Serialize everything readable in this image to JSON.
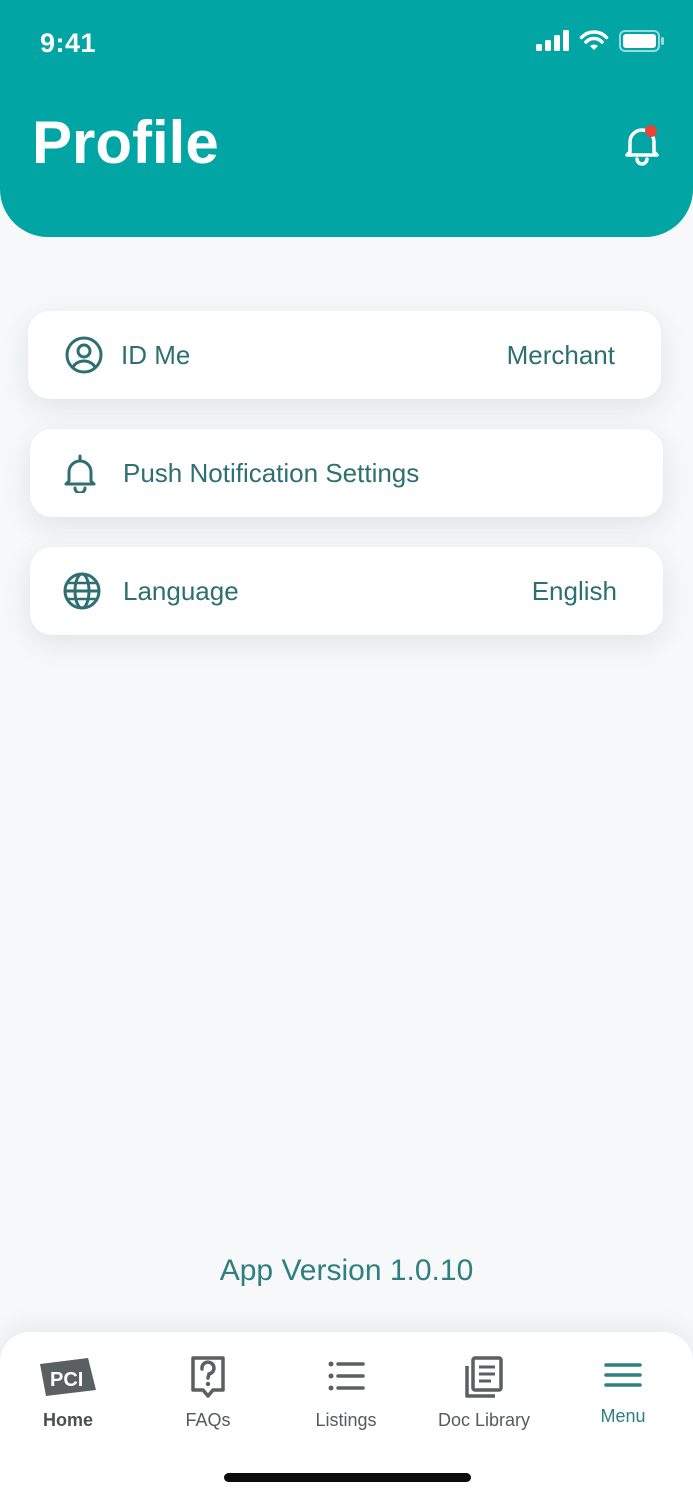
{
  "status_bar": {
    "time": "9:41"
  },
  "header": {
    "title": "Profile"
  },
  "settings": [
    {
      "label": "ID Me",
      "value": "Merchant",
      "icon": "user-circle-icon"
    },
    {
      "label": "Push Notification Settings",
      "value": "",
      "icon": "bell-icon"
    },
    {
      "label": "Language",
      "value": "English",
      "icon": "globe-icon"
    }
  ],
  "footer": {
    "app_version": "App Version 1.0.10"
  },
  "tabbar": {
    "home": "Home",
    "faqs": "FAQs",
    "listings": "Listings",
    "doc_library": "Doc Library",
    "menu": "Menu",
    "home_logo_text": "PCI"
  },
  "colors": {
    "primary": "#01a5a4",
    "text": "#2e6f72",
    "notification_dot": "#ea4335"
  }
}
